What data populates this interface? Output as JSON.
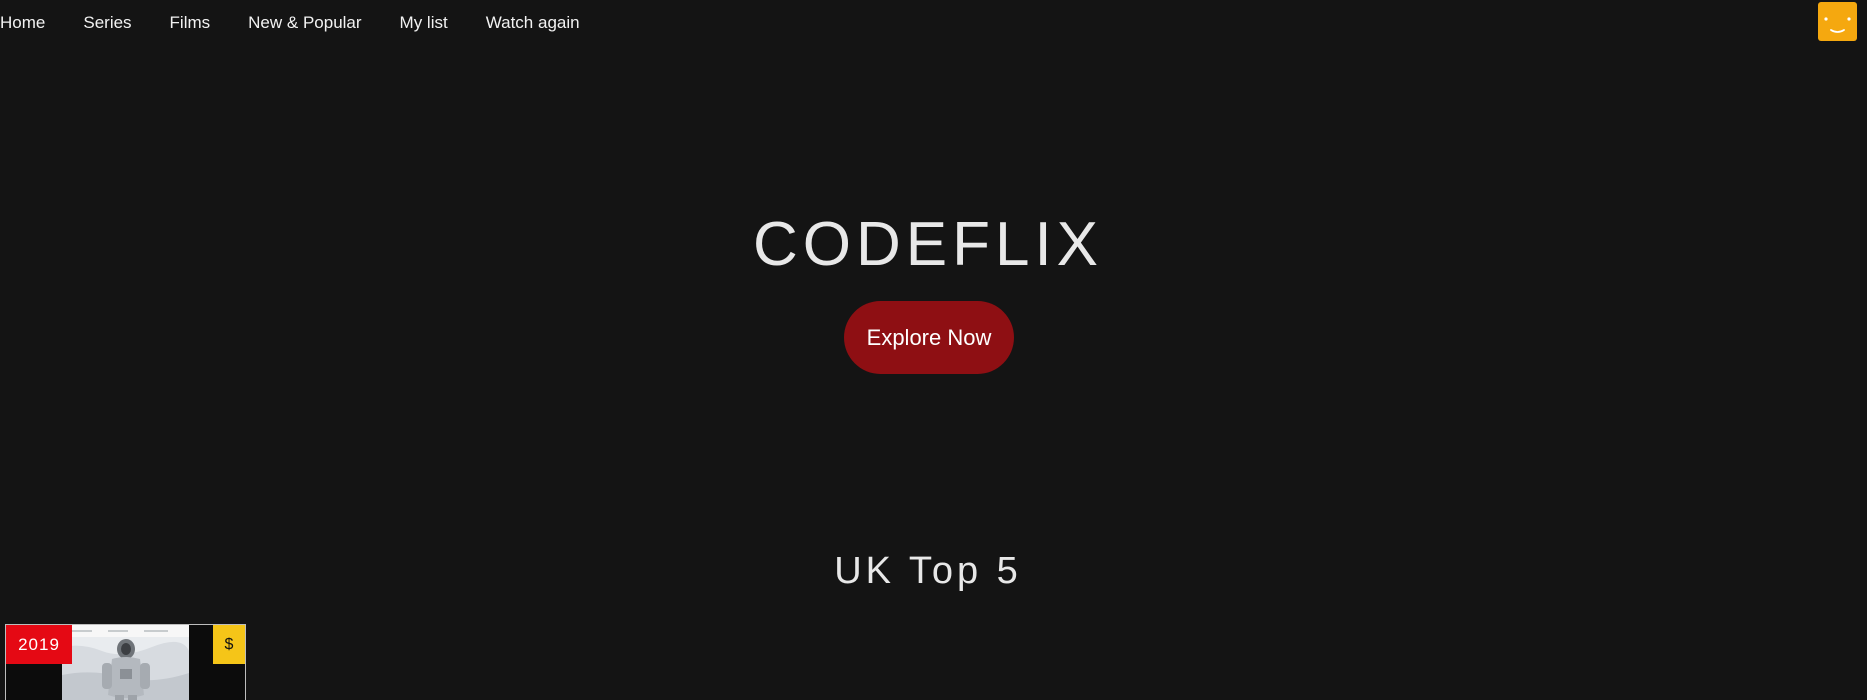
{
  "nav": {
    "items": [
      {
        "label": "Home"
      },
      {
        "label": "Series"
      },
      {
        "label": "Films"
      },
      {
        "label": "New & Popular"
      },
      {
        "label": "My list"
      },
      {
        "label": "Watch again"
      }
    ]
  },
  "profile": {
    "icon": "smiley-avatar-icon",
    "color": "#f5a80f"
  },
  "hero": {
    "title": "CODEFLIX",
    "button_label": "Explore Now",
    "button_color": "#8e0f13"
  },
  "section": {
    "title": "UK Top 5",
    "cards": [
      {
        "year": "2019",
        "price": "$",
        "year_color": "#e50914",
        "price_color": "#f5c518"
      }
    ]
  },
  "theme": {
    "background": "#141414",
    "text": "#e8e8e8"
  }
}
